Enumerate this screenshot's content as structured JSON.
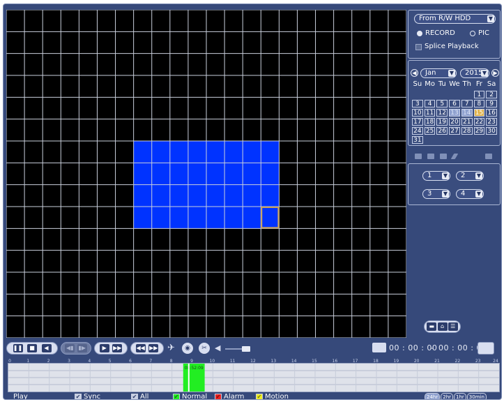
{
  "source_select": {
    "value": "From R/W HDD"
  },
  "mode": {
    "record_label": "RECORD",
    "pic_label": "PIC",
    "selected": "RECORD"
  },
  "splice_label": "Splice Playback",
  "calendar": {
    "month": "Jan",
    "year": "2015",
    "weekdays": [
      "Su",
      "Mo",
      "Tu",
      "We",
      "Th",
      "Fr",
      "Sa"
    ],
    "first_weekday_index": 4,
    "days": [
      "1",
      "2",
      "3",
      "4",
      "5",
      "6",
      "7",
      "8",
      "9",
      "10",
      "11",
      "12",
      "13",
      "14",
      "15",
      "16",
      "17",
      "18",
      "19",
      "20",
      "21",
      "22",
      "23",
      "24",
      "25",
      "26",
      "27",
      "28",
      "29",
      "30",
      "31"
    ],
    "record_days": [
      "13",
      "14"
    ],
    "current_day": "15"
  },
  "channels": {
    "ch1": "1",
    "ch2": "2",
    "ch3": "3",
    "ch4": "4"
  },
  "time": {
    "current": "00 : 00 : 00",
    "total": "00 : 00 : 00"
  },
  "timeline": {
    "hours": [
      "0",
      "1",
      "2",
      "3",
      "4",
      "5",
      "6",
      "7",
      "8",
      "9",
      "10",
      "11",
      "12",
      "13",
      "14",
      "15",
      "16",
      "17",
      "18",
      "19",
      "20",
      "21",
      "22",
      "23",
      "24"
    ],
    "marker_label": "08:52:09",
    "normal_segment": {
      "start_hour": 8.55,
      "end_hour": 9.6
    }
  },
  "status": {
    "play_label": "Play"
  },
  "legend": {
    "sync": "Sync",
    "all": "All",
    "normal": "Normal",
    "alarm": "Alarm",
    "motion": "Motion"
  },
  "zoom": [
    "24hr",
    "2hr",
    "1hr",
    "30min"
  ],
  "colors": {
    "background": "#36497a",
    "motion_region": "#0033ff",
    "grid_line": "#ffffff",
    "normal": "#22ee22",
    "alarm": "#ee2222",
    "motion": "#eeee22",
    "highlight_day": "#e0b24a"
  },
  "grid": {
    "cols": 22,
    "rows": 15,
    "region": {
      "col_start": 7,
      "col_end": 15,
      "row_start": 6,
      "row_end": 10
    }
  }
}
